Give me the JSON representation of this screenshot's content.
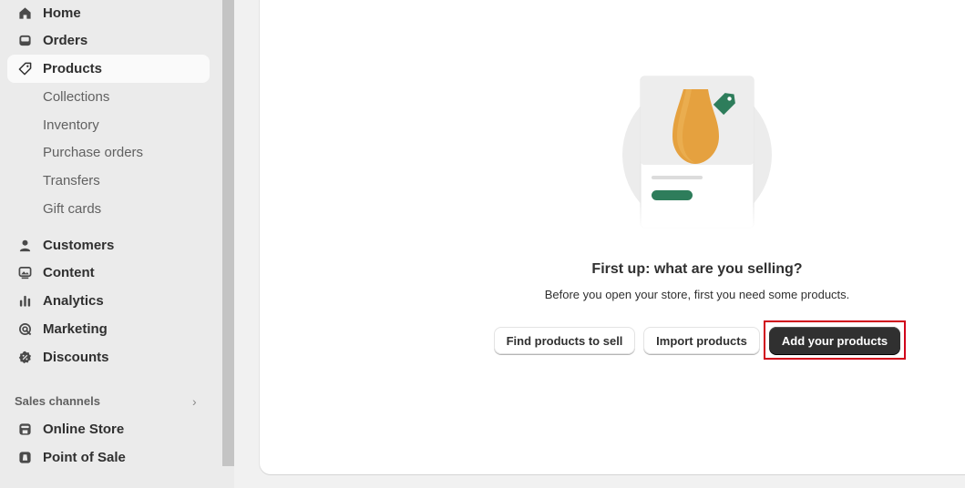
{
  "sidebar": {
    "items": [
      {
        "label": "Home",
        "icon": "home-icon"
      },
      {
        "label": "Orders",
        "icon": "inbox-icon"
      },
      {
        "label": "Products",
        "icon": "tag-icon"
      },
      {
        "label": "Customers",
        "icon": "person-icon"
      },
      {
        "label": "Content",
        "icon": "image-icon"
      },
      {
        "label": "Analytics",
        "icon": "bar-chart-icon"
      },
      {
        "label": "Marketing",
        "icon": "target-icon"
      },
      {
        "label": "Discounts",
        "icon": "discount-icon"
      }
    ],
    "product_subitems": [
      "Collections",
      "Inventory",
      "Purchase orders",
      "Transfers",
      "Gift cards"
    ],
    "sales_channels_label": "Sales channels",
    "channels": [
      {
        "label": "Online Store",
        "icon": "store-icon"
      },
      {
        "label": "Point of Sale",
        "icon": "pos-icon"
      }
    ]
  },
  "empty_state": {
    "title": "First up: what are you selling?",
    "subtitle": "Before you open your store, first you need some products.",
    "find_button": "Find products to sell",
    "import_button": "Import products",
    "add_button": "Add your products"
  },
  "colors": {
    "accent_green": "#2e7d5b",
    "vase_orange": "#e5a13f",
    "primary_button": "#303030",
    "highlight": "#d0021b"
  }
}
